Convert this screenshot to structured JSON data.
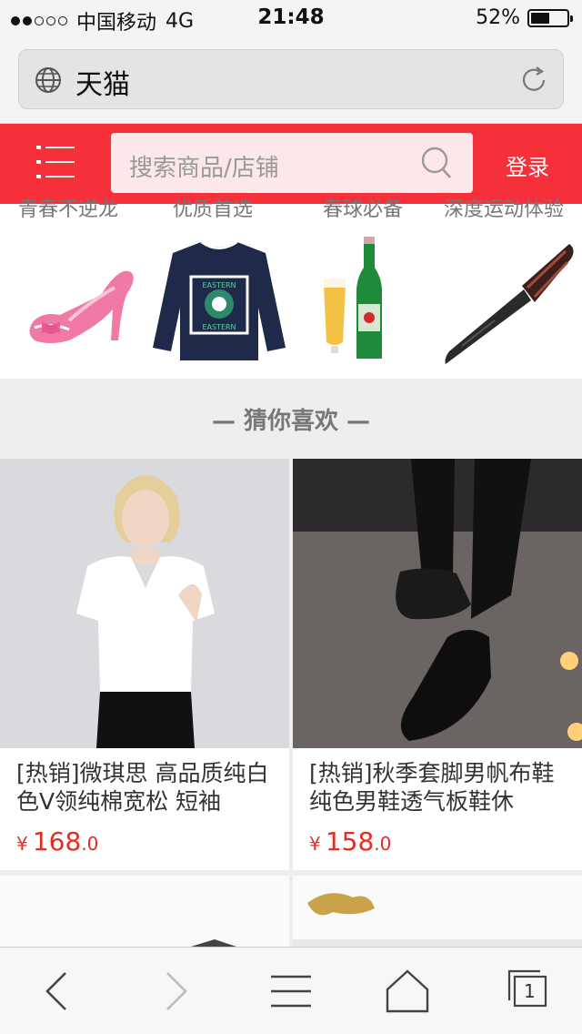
{
  "status_bar": {
    "carrier": "中国移动",
    "network": "4G",
    "time": "21:48",
    "battery_percent": "52%",
    "battery_level": 0.52,
    "signal_bars_filled": 2,
    "signal_bars_total": 5
  },
  "address_bar": {
    "url_text": "天猫"
  },
  "header": {
    "search_placeholder": "搜索商品/店铺",
    "login_label": "登录",
    "brand_color": "#f5303a"
  },
  "categories": [
    {
      "label": "青春不逆龙",
      "icon": "pink-high-heel-shoe"
    },
    {
      "label": "优质首选",
      "icon": "navy-sweatshirt"
    },
    {
      "label": "春球必备",
      "icon": "beer-bottle-and-glass"
    },
    {
      "label": "深度运动体验",
      "icon": "folding-knife"
    }
  ],
  "section": {
    "title": "— 猜你喜欢 —"
  },
  "products": [
    {
      "title": "[热销]微琪思 高品质纯白色V领纯棉宽松 短袖",
      "currency": "¥",
      "price_int": "168",
      "price_dec": ".0"
    },
    {
      "title": "[热销]秋季套脚男帆布鞋纯色男鞋透气板鞋休",
      "currency": "¥",
      "price_int": "158",
      "price_dec": ".0"
    }
  ],
  "toolbar": {
    "tab_count": "1"
  }
}
